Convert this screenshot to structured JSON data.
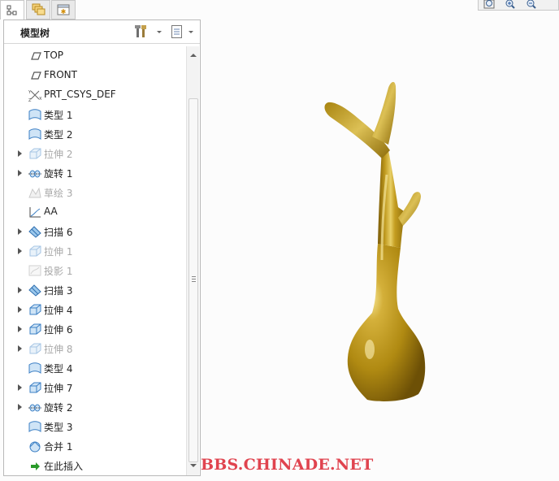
{
  "panel": {
    "title": "模型树"
  },
  "tabs": [
    {
      "name": "model-tree-tab",
      "icon": "tree-icon",
      "active": true
    },
    {
      "name": "folder-browser-tab",
      "icon": "folders-icon",
      "active": false
    },
    {
      "name": "favorites-tab",
      "icon": "favorites-icon",
      "active": false
    }
  ],
  "tree": {
    "items": [
      {
        "label": "TOP",
        "icon": "datum-plane-icon",
        "expandable": false,
        "dimmed": false
      },
      {
        "label": "FRONT",
        "icon": "datum-plane-icon",
        "expandable": false,
        "dimmed": false
      },
      {
        "label": "PRT_CSYS_DEF",
        "icon": "csys-icon",
        "expandable": false,
        "dimmed": false
      },
      {
        "label": "类型 1",
        "icon": "surface-icon",
        "expandable": false,
        "dimmed": false
      },
      {
        "label": "类型 2",
        "icon": "surface-icon",
        "expandable": false,
        "dimmed": false
      },
      {
        "label": "拉伸 2",
        "icon": "extrude-icon",
        "expandable": true,
        "dimmed": true
      },
      {
        "label": "旋转 1",
        "icon": "revolve-icon",
        "expandable": true,
        "dimmed": false
      },
      {
        "label": "草绘 3",
        "icon": "sketch-icon",
        "expandable": false,
        "dimmed": true
      },
      {
        "label": "AA",
        "icon": "datum-curve-icon",
        "expandable": false,
        "dimmed": false
      },
      {
        "label": "扫描 6",
        "icon": "sweep-icon",
        "expandable": true,
        "dimmed": false
      },
      {
        "label": "拉伸 1",
        "icon": "extrude-icon",
        "expandable": true,
        "dimmed": true
      },
      {
        "label": "投影 1",
        "icon": "projection-icon",
        "expandable": false,
        "dimmed": true
      },
      {
        "label": "扫描 3",
        "icon": "sweep-icon",
        "expandable": true,
        "dimmed": false
      },
      {
        "label": "拉伸 4",
        "icon": "extrude-icon",
        "expandable": true,
        "dimmed": false
      },
      {
        "label": "拉伸 6",
        "icon": "extrude-icon",
        "expandable": true,
        "dimmed": false
      },
      {
        "label": "拉伸 8",
        "icon": "extrude-icon",
        "expandable": true,
        "dimmed": true
      },
      {
        "label": "类型 4",
        "icon": "surface-icon",
        "expandable": false,
        "dimmed": false
      },
      {
        "label": "拉伸 7",
        "icon": "extrude-icon",
        "expandable": true,
        "dimmed": false
      },
      {
        "label": "旋转 2",
        "icon": "revolve-icon",
        "expandable": true,
        "dimmed": false
      },
      {
        "label": "类型 3",
        "icon": "surface-icon",
        "expandable": false,
        "dimmed": false
      },
      {
        "label": "合并 1",
        "icon": "merge-icon",
        "expandable": false,
        "dimmed": false
      },
      {
        "label": "在此插入",
        "icon": "insert-here-icon",
        "expandable": false,
        "dimmed": false
      }
    ]
  },
  "viewbar": {
    "buttons": [
      "zoom-fit-icon",
      "zoom-in-icon",
      "zoom-out-icon"
    ]
  },
  "watermark": "BBS.CHINADE.NET",
  "colors": {
    "model": "#b8901a",
    "watermark": "#e0444f",
    "selection_blue": "#3b7fc4"
  }
}
